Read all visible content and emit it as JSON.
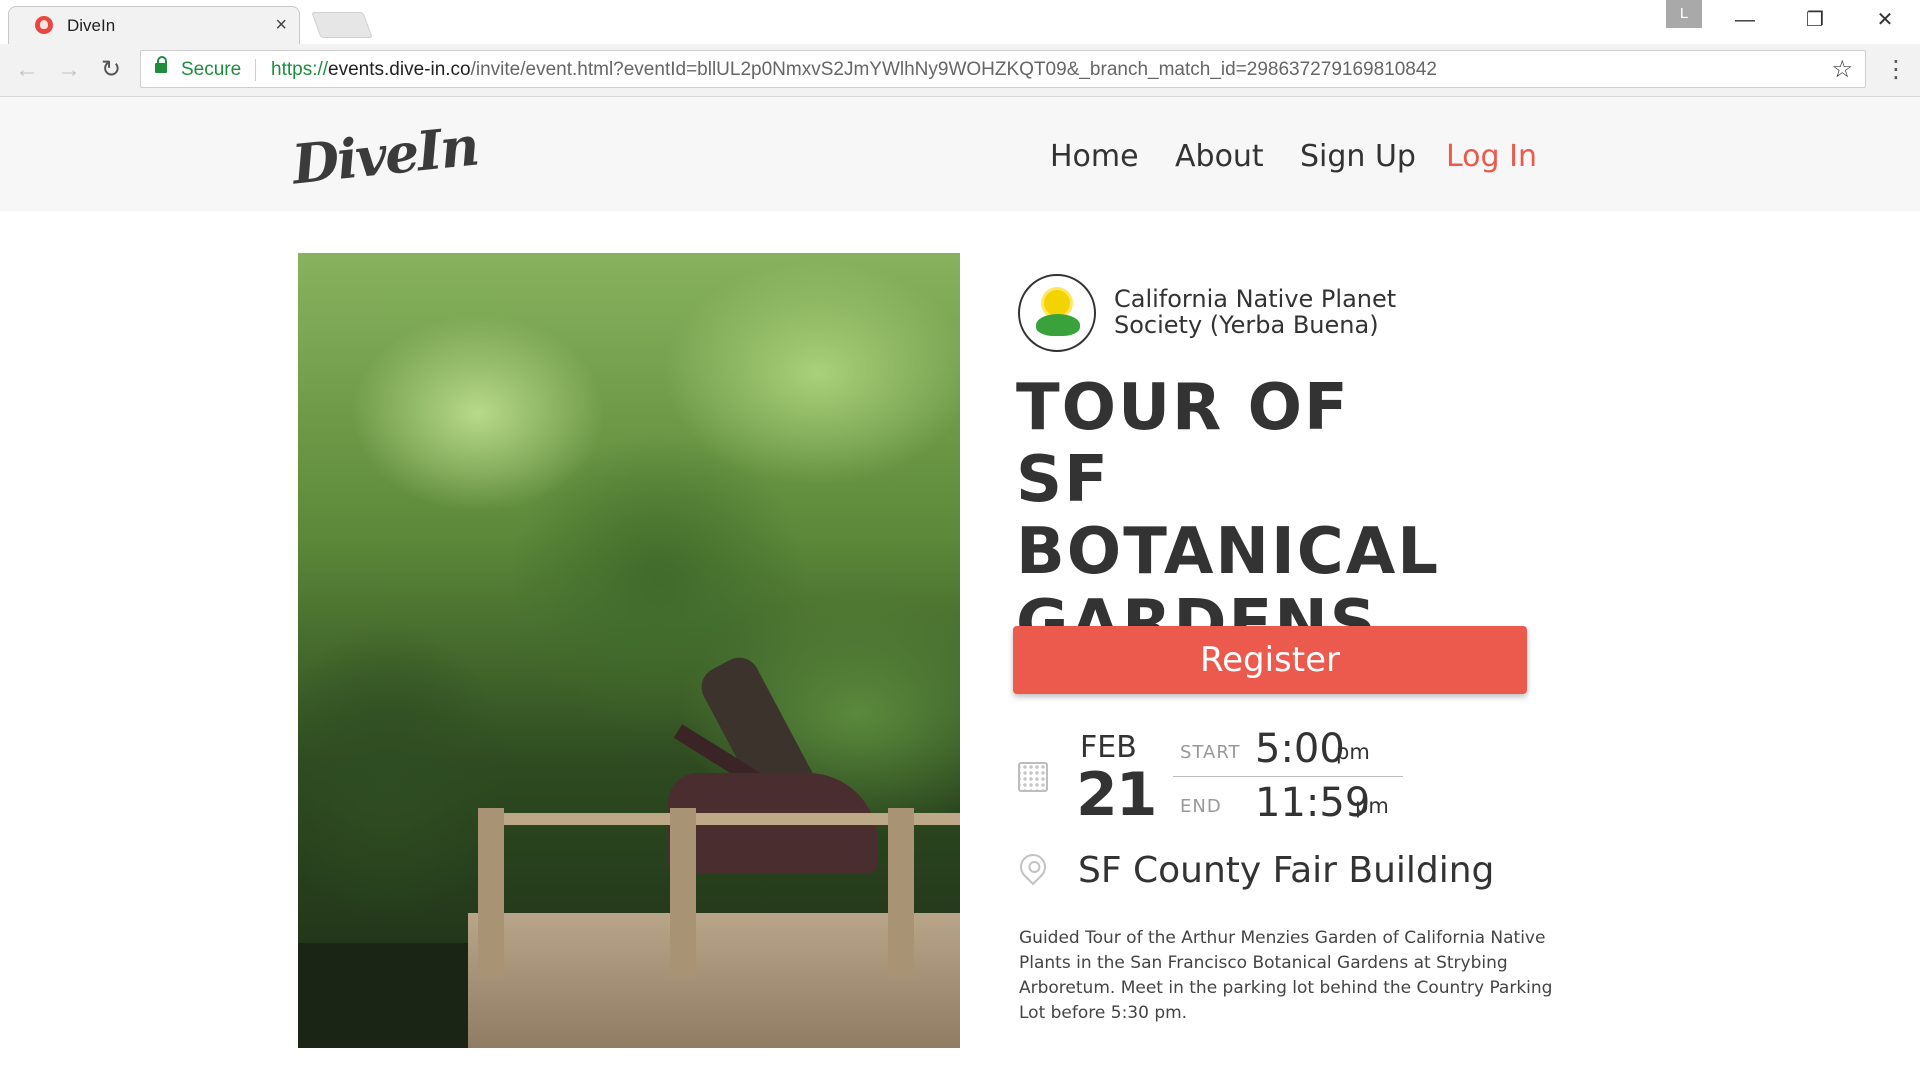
{
  "browser": {
    "tab_title": "DiveIn",
    "tab_close": "×",
    "profile_initial": "L",
    "window_controls": {
      "minimize": "—",
      "restore": "❐",
      "close": "✕"
    },
    "nav": {
      "back": "←",
      "forward": "→",
      "reload": "↻"
    },
    "secure_label": "Secure",
    "url_scheme": "https://",
    "url_host": "events.dive-in.co",
    "url_path": "/invite/event.html?eventId=bllUL2p0NmxvS2JmYWlhNy9WOHZKQT09&_branch_match_id=298637279169810842",
    "star_icon": "☆",
    "menu_icon": "⋮"
  },
  "site": {
    "logo_text": "DiveIn",
    "nav": [
      {
        "label": "Home"
      },
      {
        "label": "About"
      },
      {
        "label": "Sign Up"
      },
      {
        "label": "Log In"
      }
    ],
    "accent_color": "#ec5a4e"
  },
  "event": {
    "organizer": "California Native Planet Society (Yerba Buena)",
    "title_lines": [
      "TOUR OF",
      "SF BOTANICAL",
      "GARDENS"
    ],
    "register_label": "Register",
    "date": {
      "month": "FEB",
      "day": "21"
    },
    "start": {
      "label": "START",
      "time": "5:00",
      "ampm": "pm"
    },
    "end": {
      "label": "END",
      "time": "11:59",
      "ampm": "pm"
    },
    "location": "SF County Fair Building",
    "description": "Guided Tour of the Arthur Menzies Garden of California Native Plants in the San Francisco Botanical Gardens at Strybing Arboretum. Meet in the parking lot behind the Country Parking Lot before 5:30 pm."
  }
}
